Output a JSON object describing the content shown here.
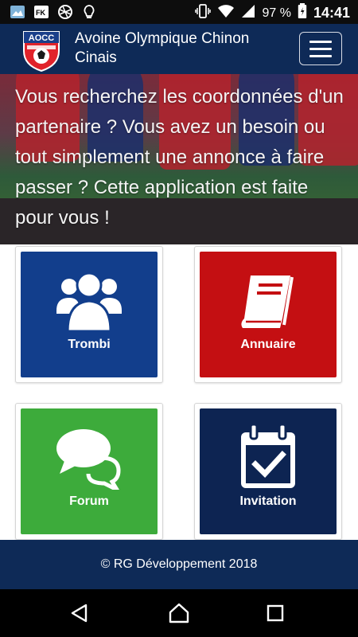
{
  "status_bar": {
    "left_icons": [
      "gallery-notification-icon",
      "fk-notification-icon",
      "ball-notification-icon",
      "bulb-notification-icon"
    ],
    "fk_label": "FK",
    "battery_percent": "97 %",
    "time": "14:41"
  },
  "app_bar": {
    "title": "Avoine Olympique Chinon Cinais",
    "logo_text": "AOCC"
  },
  "hero": {
    "text": "Vous recherchez les coordonnées d'un partenaire ? Vous avez un besoin ou tout simplement une annonce à faire passer ? Cette application est faite pour vous !"
  },
  "tiles": [
    {
      "label": "Trombi",
      "color": "#123e8c",
      "icon": "users-group-icon"
    },
    {
      "label": "Annuaire",
      "color": "#c40f12",
      "icon": "book-icon"
    },
    {
      "label": "Forum",
      "color": "#3dab3b",
      "icon": "chat-bubbles-icon"
    },
    {
      "label": "Invitation",
      "color": "#0d2452",
      "icon": "calendar-check-icon"
    }
  ],
  "footer": {
    "text": "© RG Développement 2018"
  },
  "colors": {
    "primary": "#0e2a57",
    "status_bar": "#0d0d0d"
  }
}
